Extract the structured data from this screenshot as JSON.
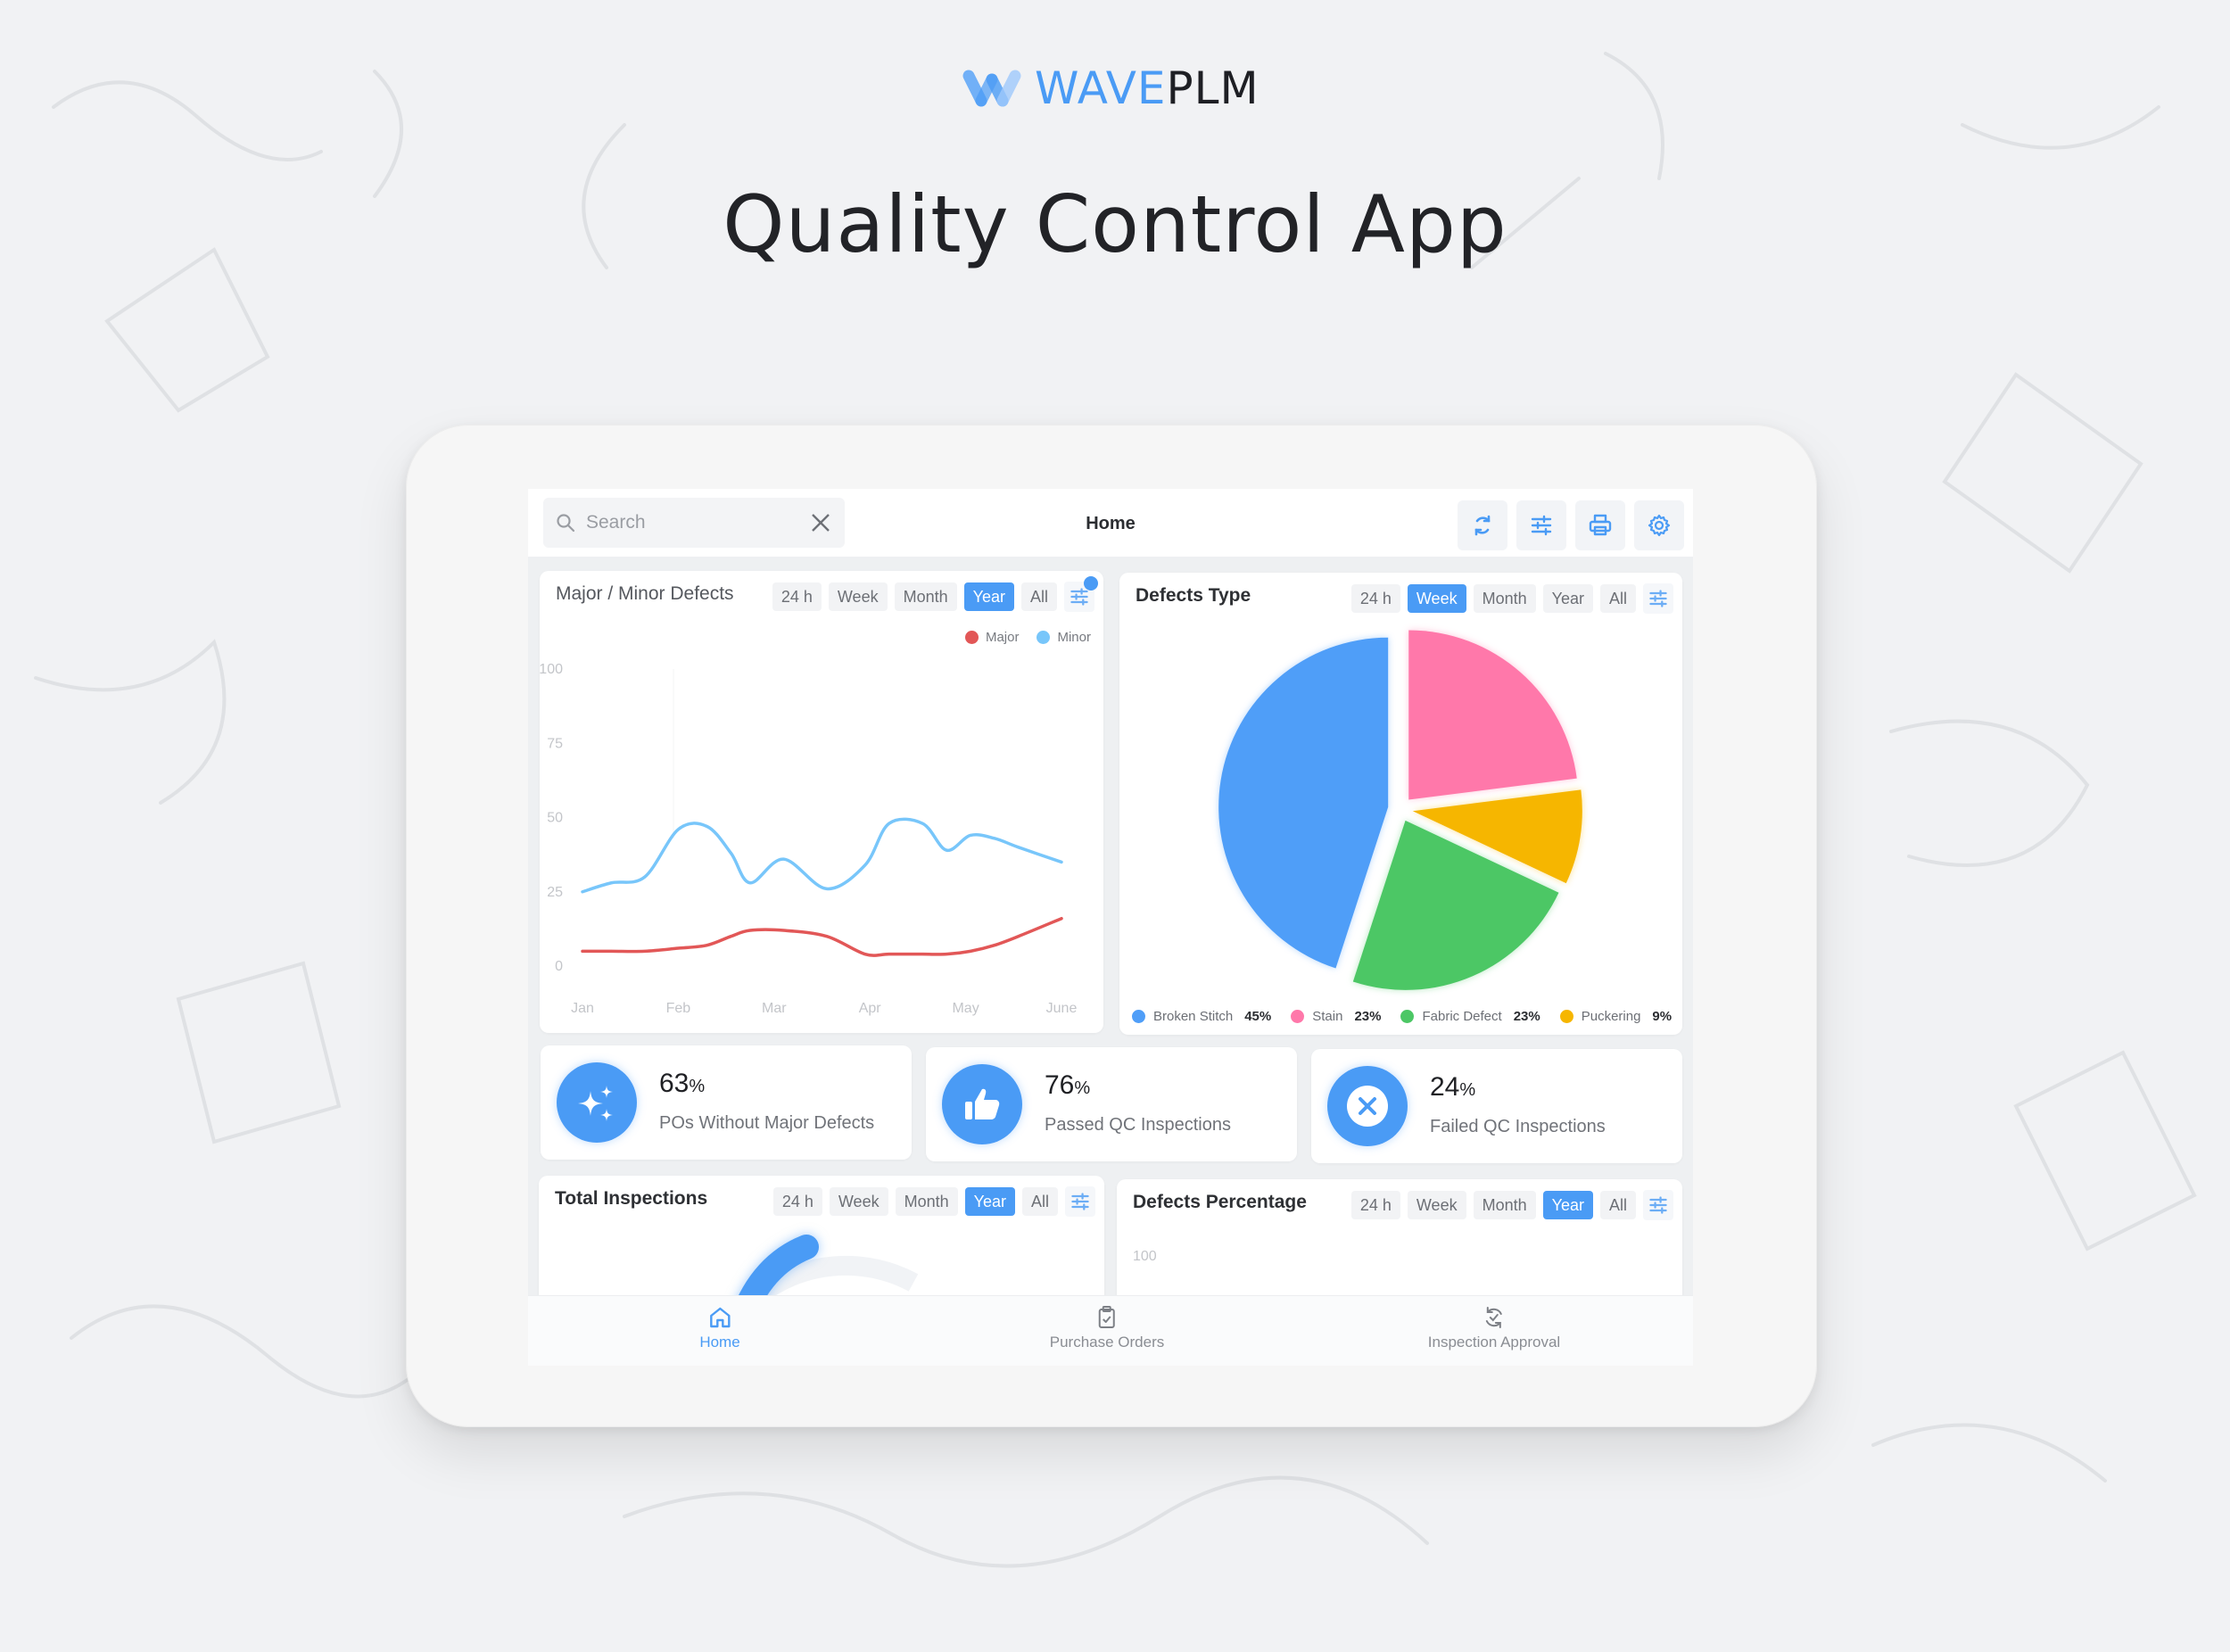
{
  "brand": {
    "logo_wave": "WAVE",
    "logo_plm": "PLM",
    "accent": "#4a9bf5",
    "dark": "#1e1f24"
  },
  "page_title": "Quality Control App",
  "topbar": {
    "search_placeholder": "Search",
    "title": "Home",
    "tools": [
      {
        "name": "refresh-icon"
      },
      {
        "name": "sliders-icon"
      },
      {
        "name": "printer-icon"
      },
      {
        "name": "gear-icon"
      }
    ]
  },
  "filters": {
    "h24": "24 h",
    "week": "Week",
    "month": "Month",
    "year": "Year",
    "all": "All"
  },
  "major_minor": {
    "title": "Major / Minor Defects",
    "active_filter": "Year",
    "legend": {
      "major": "Major",
      "minor": "Minor"
    }
  },
  "defects_type": {
    "title": "Defects Type",
    "active_filter": "Week",
    "legend": [
      {
        "label": "Broken Stitch",
        "value": "45%",
        "color": "#4f9ef8"
      },
      {
        "label": "Stain",
        "value": "23%",
        "color": "#ff78aa"
      },
      {
        "label": "Fabric Defect",
        "value": "23%",
        "color": "#4cc765"
      },
      {
        "label": "Puckering",
        "value": "9%",
        "color": "#f6b600"
      }
    ]
  },
  "stats": [
    {
      "value": "63",
      "unit": "%",
      "label": "POs Without Major Defects",
      "icon": "sparkles-icon"
    },
    {
      "value": "76",
      "unit": "%",
      "label": "Passed QC Inspections",
      "icon": "thumbs-up-icon"
    },
    {
      "value": "24",
      "unit": "%",
      "label": "Failed QC Inspections",
      "icon": "x-circle-icon"
    }
  ],
  "total_inspections": {
    "title": "Total Inspections",
    "active_filter": "Year"
  },
  "defects_percentage": {
    "title": "Defects Percentage",
    "active_filter": "Year",
    "y_top_label": "100"
  },
  "nav": [
    {
      "label": "Home",
      "icon": "home-icon",
      "active": true
    },
    {
      "label": "Purchase Orders",
      "icon": "clipboard-check-icon",
      "active": false
    },
    {
      "label": "Inspection Approval",
      "icon": "approval-cycle-icon",
      "active": false
    }
  ],
  "chart_data": [
    {
      "type": "line",
      "title": "Major / Minor Defects",
      "categories": [
        "Jan",
        "Feb",
        "Mar",
        "Apr",
        "May",
        "June"
      ],
      "x": [
        0,
        0.3,
        0.65,
        1.0,
        1.3,
        1.55,
        1.75,
        2.1,
        2.55,
        2.95,
        3.2,
        3.55,
        3.8,
        4.05,
        4.3,
        4.55,
        5.0
      ],
      "series": [
        {
          "name": "Minor",
          "color": "#78c6fa",
          "values": [
            25,
            28,
            30,
            46,
            47,
            38,
            28,
            36,
            26,
            34,
            48,
            48,
            39,
            44,
            43,
            40,
            35
          ]
        },
        {
          "name": "Major",
          "color": "#e25757",
          "values": [
            5,
            5,
            5,
            6,
            7,
            10,
            12,
            12,
            10,
            4,
            4,
            4,
            4,
            5,
            7,
            10,
            16
          ]
        }
      ],
      "yticks": [
        0,
        25,
        50,
        75,
        100
      ],
      "ylim": [
        0,
        100
      ],
      "xlabel": "",
      "ylabel": "",
      "grid": false,
      "legend": "top-right"
    },
    {
      "type": "pie",
      "title": "Defects Type",
      "labels": [
        "Broken Stitch",
        "Stain",
        "Fabric Defect",
        "Puckering"
      ],
      "values": [
        45,
        23,
        23,
        9
      ],
      "colors": [
        "#4f9ef8",
        "#ff78aa",
        "#4cc765",
        "#f6b600"
      ],
      "legend": "bottom"
    }
  ]
}
